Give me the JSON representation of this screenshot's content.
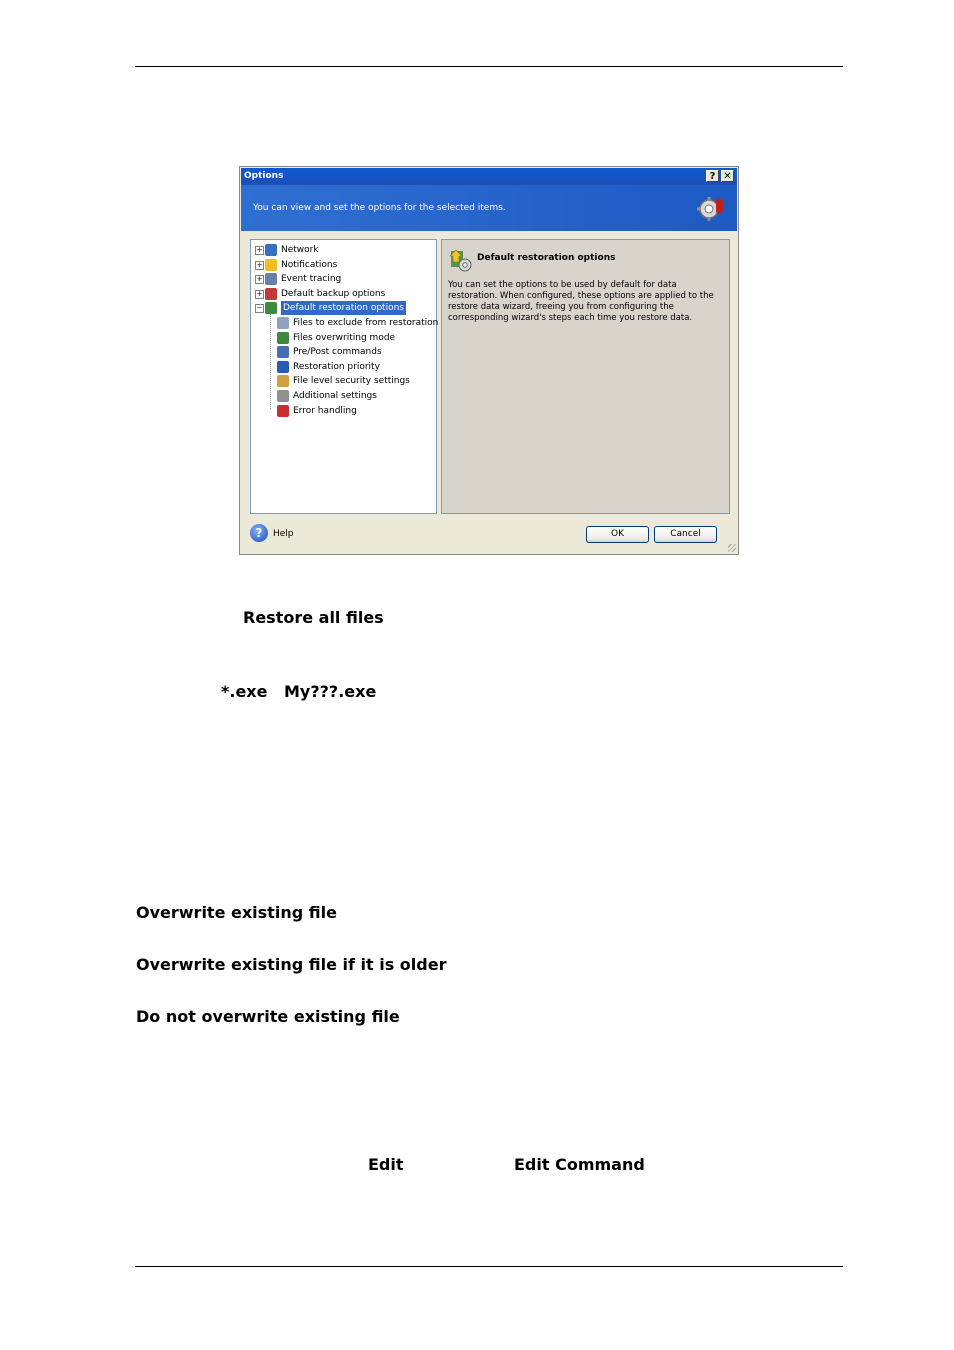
{
  "dialog": {
    "title": "Options",
    "help_glyph": "?",
    "close_glyph": "✕",
    "banner_text": "You can view and set the options for the selected items.",
    "tree": [
      {
        "label": "Network",
        "expander": "+",
        "icon": "network-icon",
        "color": "#3a6fc4"
      },
      {
        "label": "Notifications",
        "expander": "+",
        "icon": "notification-icon",
        "color": "#f0c020"
      },
      {
        "label": "Event tracing",
        "expander": "+",
        "icon": "event-tracing-icon",
        "color": "#6a7fa8"
      },
      {
        "label": "Default backup options",
        "expander": "+",
        "icon": "backup-options-icon",
        "color": "#c03a3a"
      },
      {
        "label": "Default restoration options",
        "expander": "−",
        "icon": "restoration-options-icon",
        "color": "#3d8a3d",
        "selected": true
      },
      {
        "label": "Files to exclude from restoration",
        "icon": "exclude-files-icon",
        "color": "#8fa0c0"
      },
      {
        "label": "Files overwriting mode",
        "icon": "overwrite-mode-icon",
        "color": "#3d8a3d"
      },
      {
        "label": "Pre/Post commands",
        "icon": "commands-icon",
        "color": "#4a6fb0"
      },
      {
        "label": "Restoration priority",
        "icon": "priority-icon",
        "color": "#2a5bb5"
      },
      {
        "label": "File level security settings",
        "icon": "security-icon",
        "color": "#d0a040"
      },
      {
        "label": "Additional settings",
        "icon": "settings-icon",
        "color": "#909090"
      },
      {
        "label": "Error handling",
        "icon": "error-handling-icon",
        "color": "#c83030"
      }
    ],
    "info_title": "Default restoration options",
    "info_text": "You can set the options to be used by default for data restoration. When configured, these options are applied to the restore data wizard, freeing you from configuring the corresponding wizard's steps each time you restore data.",
    "help_label": "Help",
    "ok_label": "OK",
    "cancel_label": "Cancel"
  },
  "document": {
    "restore_all_files": "Restore all files",
    "mask_exe": "*.exe",
    "mask_my": "My???.exe",
    "overwrite_existing": "Overwrite existing file",
    "overwrite_if_older": "Overwrite existing file if it is older",
    "do_not_overwrite": "Do not overwrite existing file",
    "edit": "Edit",
    "edit_command": "Edit Command"
  }
}
